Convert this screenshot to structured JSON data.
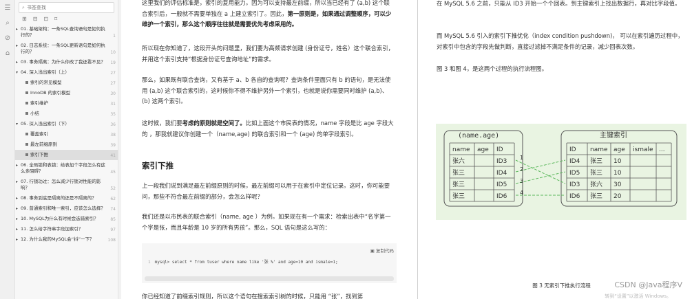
{
  "rail": {
    "icons": [
      "list-icon",
      "search-icon",
      "link-icon",
      "stamp-icon"
    ]
  },
  "sidebar": {
    "search_placeholder": "书签查找",
    "items": [
      {
        "label": "01. 基础架构：一条SQL查询语句是如何执行的？",
        "page": "1",
        "toggle": "▸"
      },
      {
        "label": "02. 日志系统：一条SQL更新语句是如何执行的？",
        "page": "10",
        "toggle": "▸"
      },
      {
        "label": "03. 事务隔离：为什么你改了我还看不见？",
        "page": "19",
        "toggle": "▸"
      },
      {
        "label": "04. 深入浅出索引（上）",
        "page": "27",
        "toggle": "▾"
      },
      {
        "label": "索引的常见模型",
        "page": "27",
        "sub": true
      },
      {
        "label": "InnoDB 的索引模型",
        "page": "30",
        "sub": true
      },
      {
        "label": "索引维护",
        "page": "31",
        "sub": true
      },
      {
        "label": "小结",
        "page": "35",
        "sub": true
      },
      {
        "label": "05. 深入浅出索引（下）",
        "page": "36",
        "toggle": "▾"
      },
      {
        "label": "覆盖索引",
        "page": "38",
        "sub": true
      },
      {
        "label": "最左前缀原则",
        "page": "39",
        "sub": true
      },
      {
        "label": "索引下推",
        "page": "41",
        "sub": true,
        "active": true
      },
      {
        "label": "06. 全局锁和表锁：给表加个字段怎么有这么多阻碍？",
        "page": "45",
        "toggle": "▸"
      },
      {
        "label": "07. 行锁功过：怎么减少行锁对性能的影响？",
        "page": "52",
        "toggle": "▸"
      },
      {
        "label": "08. 事务到底是隔离的还是不隔离的？",
        "page": "62",
        "toggle": "▸"
      },
      {
        "label": "09. 普通索引和唯一索引，应该怎么选择？",
        "page": "74",
        "toggle": "▸"
      },
      {
        "label": "10. MySQL为什么有时候会选错索引？",
        "page": "85",
        "toggle": "▸"
      },
      {
        "label": "11. 怎么给字符串字段加索引？",
        "page": "97",
        "toggle": "▸"
      },
      {
        "label": "12. 为什么我的MySQL会“抖”一下？",
        "page": "108",
        "toggle": "▸"
      }
    ]
  },
  "doc": {
    "p1a": "这里我们的评估标准是，索引的复用能力。因为可以支持最左前缀，所以当已经有了 (a,b) 这个联合索引后，一般就不需要单独在 a 上建立索引了。因此，",
    "p1b": "第一原则是，如果通过调整顺序，可以少维护一个索引，那么这个顺序往往就是需要优先考虑采用的。",
    "p2": "所以现在你知道了，这段开头的问题里，我们要为高频请求创建 (身份证号，姓名）这个联合索引，并用这个索引支持“根据身份证号查询地址”的需求。",
    "p3": "那么，如果既有联合查询，又有基于 a、b 各自的查询呢？查询条件里面只有 b 的语句，是无法使用 (a,b) 这个联合索引的，这时候你不得不维护另外一个索引，也就是说你需要同时维护 (a,b)、(b) 这两个索引。",
    "p4a": "这时候，我们要",
    "p4b": "考虑的原则就是空间了。",
    "p4c": "比如上面这个市民表的情况，name 字段是比 age 字段大的 ，那我就建议你创建一个（name,age) 的联合索引和一个 (age) 的单字段索引。",
    "h2": "索引下推",
    "p5": "上一段我们说到满足最左前缀原则的时候，最左前缀可以用于在索引中定位记录。这时，你可能要问，那些不符合最左前缀的部分，会怎么样呢？",
    "p6": "我们还是以市民表的联合索引（name, age ）为例。如果现在有一个需求：检索出表中“名字第一个字是张，而且年龄是 10 岁的所有男孩”。那么，SQL 语句是这么写的：",
    "copy": "复制代码",
    "code_num": "1",
    "code": "mysql> select * from tuser where name like '张 %' and age=10 and ismale=1;",
    "p7": "你已经知道了前缀索引规则，所以这个语句在搜索索引树的时候，只能用 “张”，找到第"
  },
  "page2": {
    "p1": "在 MySQL 5.6 之前，只能从 ID3 开始一个个回表。到主键索引上找出数据行，再对比字段值。",
    "p2": "而 MySQL 5.6 引入的索引下推优化（index condition pushdown)， 可以在索引遍历过程中，对索引中包含的字段先做判断，直接过滤掉不满足条件的记录，减少回表次数。",
    "p3": "图 3 和图 4，是这两个过程的执行流程图。",
    "figure": {
      "left_title": "(name.age)",
      "left_headers": [
        "name",
        "age",
        "ID"
      ],
      "left_rows": [
        [
          "张六",
          "",
          "ID3"
        ],
        [
          "张三",
          "",
          "ID4"
        ],
        [
          "张三",
          "",
          "ID5"
        ],
        [
          "张三",
          "",
          "ID6"
        ]
      ],
      "arrow_nums": [
        "1",
        "2",
        "3",
        "4"
      ],
      "right_title": "主键索引",
      "right_headers": [
        "ID",
        "name",
        "age",
        "ismale",
        "..."
      ],
      "right_rows": [
        [
          "ID4",
          "张三",
          "10",
          "",
          ""
        ],
        [
          "ID5",
          "张三",
          "10",
          "",
          ""
        ],
        [
          "ID3",
          "张六",
          "30",
          "",
          ""
        ],
        [
          "ID6",
          "张三",
          "20",
          "",
          ""
        ]
      ]
    },
    "caption": "图 3 无索引下推执行流程",
    "watermark": "CSDN @Java程序V",
    "watermark2": "转到“设置”以激活 Windows。"
  }
}
